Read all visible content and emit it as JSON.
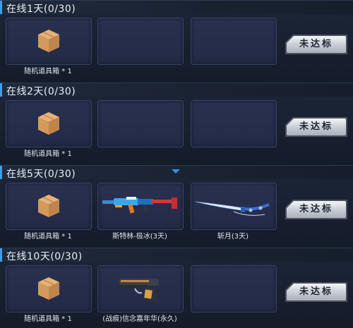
{
  "rewards": [
    {
      "title": "在线1天(0/30)",
      "slots": [
        {
          "item": "crate",
          "label": "随机道具箱 * 1"
        },
        {
          "item": "",
          "label": ""
        },
        {
          "item": "",
          "label": ""
        }
      ],
      "status": "未达标"
    },
    {
      "title": "在线2天(0/30)",
      "slots": [
        {
          "item": "crate",
          "label": "随机道具箱 * 1"
        },
        {
          "item": "",
          "label": ""
        },
        {
          "item": "",
          "label": ""
        }
      ],
      "status": "未达标"
    },
    {
      "title": "在线5天(0/30)",
      "slots": [
        {
          "item": "crate",
          "label": "随机道具箱 * 1"
        },
        {
          "item": "rifle-icon",
          "label": "斯特林-极冰(3天)"
        },
        {
          "item": "sword-icon",
          "label": "斩月(3天)"
        }
      ],
      "status": "未达标"
    },
    {
      "title": "在线10天(0/30)",
      "slots": [
        {
          "item": "crate",
          "label": "随机道具箱 * 1"
        },
        {
          "item": "pistol-icon",
          "label": "(战痕)信念嘉年华(永久)"
        },
        {
          "item": "",
          "label": ""
        }
      ],
      "status": "未达标"
    }
  ],
  "colors": {
    "accent": "#3aa0e8",
    "slot": "#2a3150",
    "button": "#d8dde3"
  }
}
